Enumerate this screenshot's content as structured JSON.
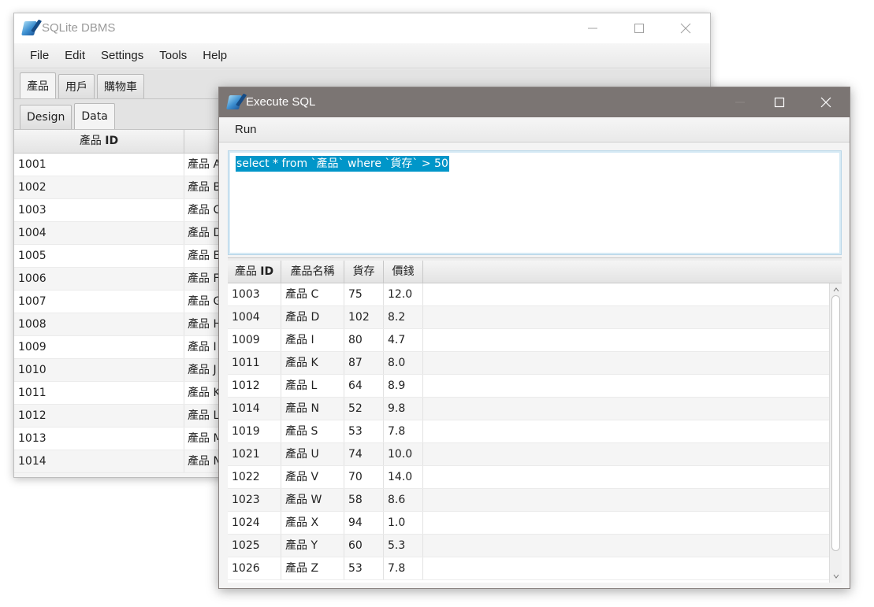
{
  "main_window": {
    "title": "SQLite DBMS",
    "menu": [
      "File",
      "Edit",
      "Settings",
      "Tools",
      "Help"
    ],
    "tabs": [
      "產品",
      "用戶",
      "購物車"
    ],
    "subtabs": [
      "Design",
      "Data"
    ],
    "table": {
      "header_col1_prefix": "產品",
      "header_col1_bold": "ID",
      "rows": [
        {
          "id": "1001",
          "name": "產品 A"
        },
        {
          "id": "1002",
          "name": "產品 B"
        },
        {
          "id": "1003",
          "name": "產品 C"
        },
        {
          "id": "1004",
          "name": "產品 D"
        },
        {
          "id": "1005",
          "name": "產品 E"
        },
        {
          "id": "1006",
          "name": "產品 F"
        },
        {
          "id": "1007",
          "name": "產品 G"
        },
        {
          "id": "1008",
          "name": "產品 H"
        },
        {
          "id": "1009",
          "name": "產品 I"
        },
        {
          "id": "1010",
          "name": "產品 J"
        },
        {
          "id": "1011",
          "name": "產品 K"
        },
        {
          "id": "1012",
          "name": "產品 L"
        },
        {
          "id": "1013",
          "name": "產品 M"
        },
        {
          "id": "1014",
          "name": "產品 N"
        }
      ]
    }
  },
  "exec_window": {
    "title": "Execute SQL",
    "menu": [
      "Run"
    ],
    "sql_text": "select * from `產品` where `貨存` > 50",
    "results": {
      "header_col1_prefix": "產品",
      "header_col1_bold": "ID",
      "columns": [
        "產品名稱",
        "貨存",
        "價錢"
      ],
      "rows": [
        [
          "1003",
          "產品 C",
          "75",
          "12.0"
        ],
        [
          "1004",
          "產品 D",
          "102",
          "8.2"
        ],
        [
          "1009",
          "產品 I",
          "80",
          "4.7"
        ],
        [
          "1011",
          "產品 K",
          "87",
          "8.0"
        ],
        [
          "1012",
          "產品 L",
          "64",
          "8.9"
        ],
        [
          "1014",
          "產品 N",
          "52",
          "9.8"
        ],
        [
          "1019",
          "產品 S",
          "53",
          "7.8"
        ],
        [
          "1021",
          "產品 U",
          "74",
          "10.0"
        ],
        [
          "1022",
          "產品 V",
          "70",
          "14.0"
        ],
        [
          "1023",
          "產品 W",
          "58",
          "8.6"
        ],
        [
          "1024",
          "產品 X",
          "94",
          "1.0"
        ],
        [
          "1025",
          "產品 Y",
          "60",
          "5.3"
        ],
        [
          "1026",
          "產品 Z",
          "53",
          "7.8"
        ]
      ]
    }
  },
  "colors": {
    "exec_titlebar": "#7b7573",
    "selection": "#0096c9"
  }
}
